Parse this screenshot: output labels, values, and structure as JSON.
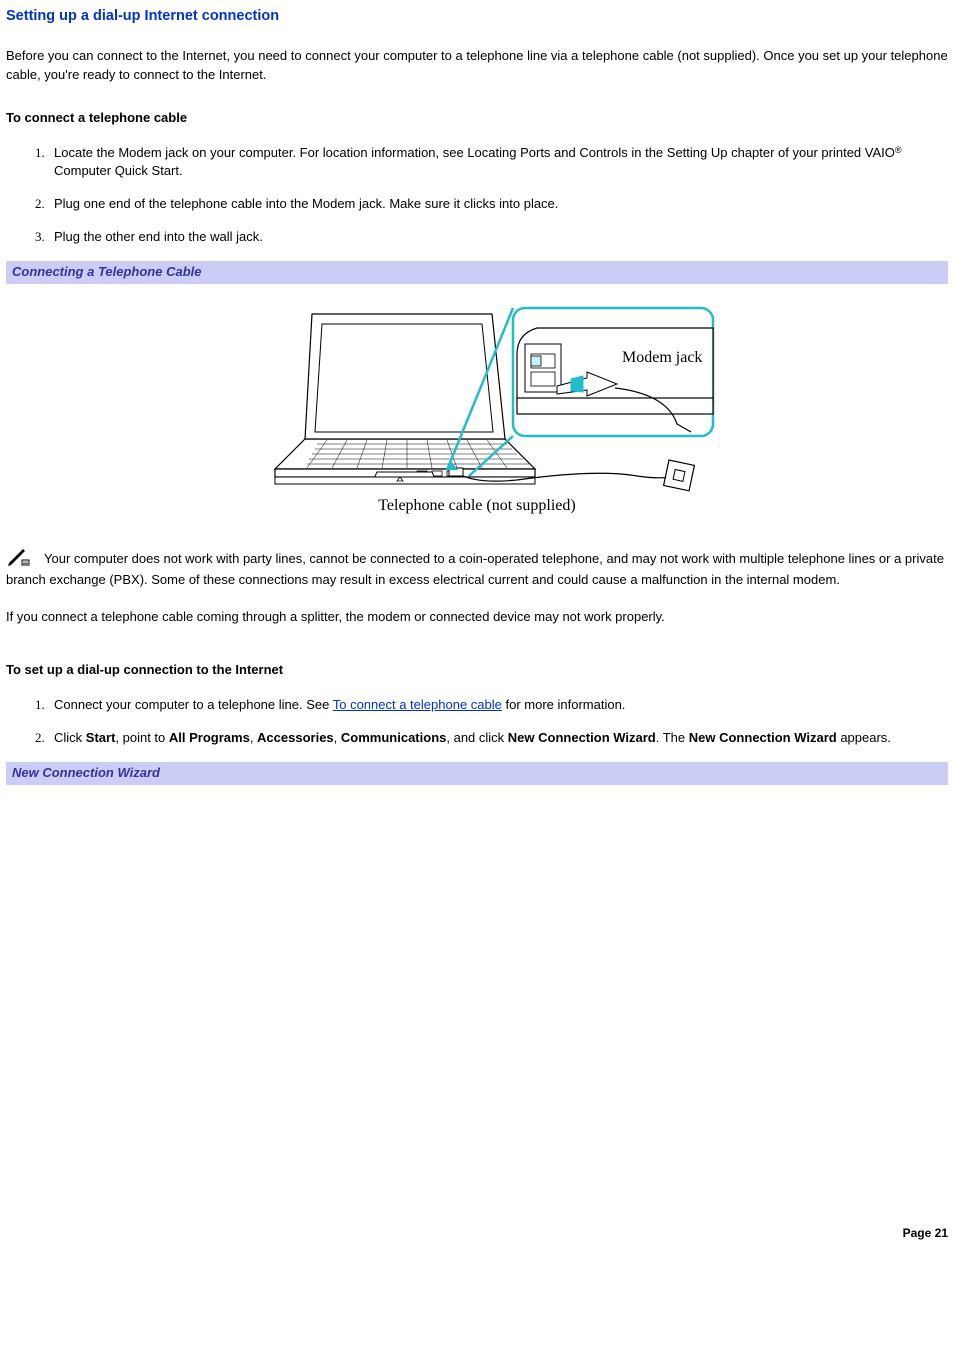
{
  "heading": "Setting up a dial-up Internet connection",
  "intro": "Before you can connect to the Internet, you need to connect your computer to a telephone line via a telephone cable (not supplied). Once you set up your telephone cable, you're ready to connect to the Internet.",
  "sub1": "To connect a telephone cable",
  "steps1": {
    "a_pre": "Locate the Modem jack on your computer. For location information, see Locating Ports and Controls in the Setting Up chapter of your printed VAIO",
    "a_post": " Computer Quick Start.",
    "reg": "®",
    "b": "Plug one end of the telephone cable into the Modem jack. Make sure it clicks into place.",
    "c": "Plug the other end into the wall jack."
  },
  "fig1": {
    "caption": "Connecting a Telephone Cable",
    "label_modem": "Modem jack",
    "label_cable": "Telephone cable (not supplied)"
  },
  "note1": "Your computer does not work with party lines, cannot be connected to a coin-operated telephone, and may not work with multiple telephone lines or a private branch exchange (PBX). Some of these connections may result in excess electrical current and could cause a malfunction in the internal modem.",
  "note2": "If you connect a telephone cable coming through a splitter, the modem or connected device may not work properly.",
  "sub2": "To set up a dial-up connection to the Internet",
  "steps2": {
    "a_pre": "Connect your computer to a telephone line. See ",
    "a_link": "To connect a telephone cable",
    "a_post": " for more information.",
    "b_parts": {
      "p1": "Click ",
      "b1": "Start",
      "p2": ", point to ",
      "b2": "All Programs",
      "p3": ", ",
      "b3": "Accessories",
      "p4": ", ",
      "b4": "Communications",
      "p5": ", and click ",
      "b5": "New Connection Wizard",
      "p6": ". The ",
      "b6": "New Connection Wizard",
      "p7": " appears."
    }
  },
  "fig2": {
    "caption": "New Connection Wizard"
  },
  "footer": "Page 21"
}
